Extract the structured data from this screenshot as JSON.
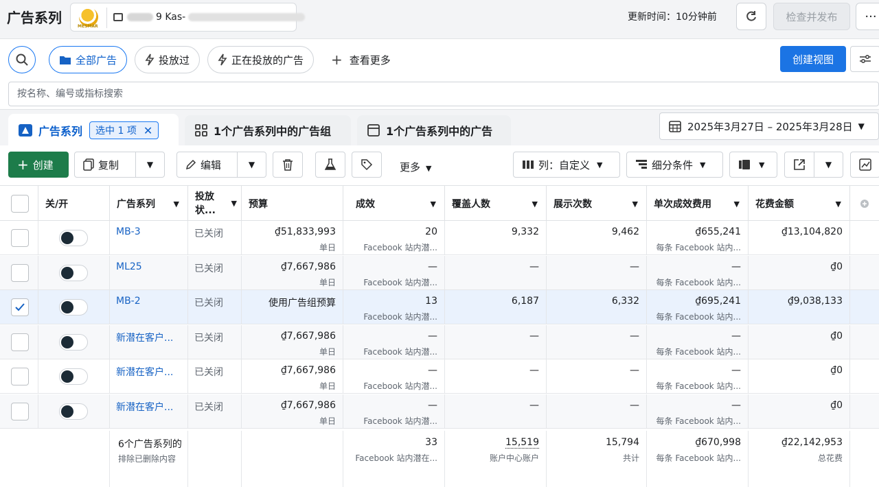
{
  "header": {
    "title": "广告系列",
    "account_name": "9 Kas-",
    "logo_text": "MESMAR",
    "update_time": "更新时间：10分钟前",
    "publish_label": "检查并发布",
    "more_label": "···"
  },
  "filters": {
    "pills": [
      "全部广告",
      "投放过",
      "正在投放的广告"
    ],
    "view_more": "查看更多",
    "create_view": "创建视图",
    "search_placeholder": "按名称、编号或指标搜索"
  },
  "tabs": {
    "campaigns": "广告系列",
    "selected_chip": "选中 1 项",
    "adsets": "1个广告系列中的广告组",
    "ads": "1个广告系列中的广告",
    "date_range": "2025年3月27日 – 2025年3月28日"
  },
  "toolbar": {
    "create": "创建",
    "copy": "复制",
    "edit": "编辑",
    "more": "更多",
    "columns": "列：自定义",
    "breakdown": "细分条件"
  },
  "table": {
    "columns": [
      "关/开",
      "广告系列",
      "投放状...",
      "预算",
      "成效",
      "覆盖人数",
      "展示次数",
      "单次成效费用",
      "花费金额"
    ],
    "rows": [
      {
        "name": "MB-3",
        "status": "已关闭",
        "budget": "₫51,833,993",
        "budget_sub": "单日",
        "results": "20",
        "results_sub": "Facebook 站内潜...",
        "reach": "9,332",
        "impressions": "9,462",
        "cpr": "₫655,241",
        "cpr_sub": "每条 Facebook 站内...",
        "spend": "₫13,104,820",
        "checked": false
      },
      {
        "name": "ML25",
        "status": "已关闭",
        "budget": "₫7,667,986",
        "budget_sub": "单日",
        "results": "—",
        "results_sub": "Facebook 站内潜...",
        "reach": "—",
        "impressions": "—",
        "cpr": "—",
        "cpr_sub": "每条 Facebook 站内...",
        "spend": "₫0",
        "checked": false
      },
      {
        "name": "MB-2",
        "status": "已关闭",
        "budget": "使用广告组预算",
        "budget_sub": "",
        "results": "13",
        "results_sub": "Facebook 站内潜...",
        "reach": "6,187",
        "impressions": "6,332",
        "cpr": "₫695,241",
        "cpr_sub": "每条 Facebook 站内...",
        "spend": "₫9,038,133",
        "checked": true
      },
      {
        "name": "新潜在客户...",
        "status": "已关闭",
        "budget": "₫7,667,986",
        "budget_sub": "单日",
        "results": "—",
        "results_sub": "Facebook 站内潜...",
        "reach": "—",
        "impressions": "—",
        "cpr": "—",
        "cpr_sub": "每条 Facebook 站内...",
        "spend": "₫0",
        "checked": false
      },
      {
        "name": "新潜在客户...",
        "status": "已关闭",
        "budget": "₫7,667,986",
        "budget_sub": "单日",
        "results": "—",
        "results_sub": "Facebook 站内潜...",
        "reach": "—",
        "impressions": "—",
        "cpr": "—",
        "cpr_sub": "每条 Facebook 站内...",
        "spend": "₫0",
        "checked": false
      },
      {
        "name": "新潜在客户...",
        "status": "已关闭",
        "budget": "₫7,667,986",
        "budget_sub": "单日",
        "results": "—",
        "results_sub": "Facebook 站内潜...",
        "reach": "—",
        "impressions": "—",
        "cpr": "—",
        "cpr_sub": "每条 Facebook 站内...",
        "spend": "₫0",
        "checked": false
      }
    ],
    "totals": {
      "label": "6个广告系列的",
      "label_sub": "排除已删除内容",
      "results": "33",
      "results_sub": "Facebook 站内潜在...",
      "reach": "15,519",
      "reach_sub": "账户中心账户",
      "impressions": "15,794",
      "impressions_sub": "共计",
      "cpr": "₫670,998",
      "cpr_sub": "每条 Facebook 站内...",
      "spend": "₫22,142,953",
      "spend_sub": "总花费"
    }
  },
  "colors": {
    "primary": "#1b74e4",
    "create_green": "#1d7c4a",
    "link": "#1662c4"
  }
}
